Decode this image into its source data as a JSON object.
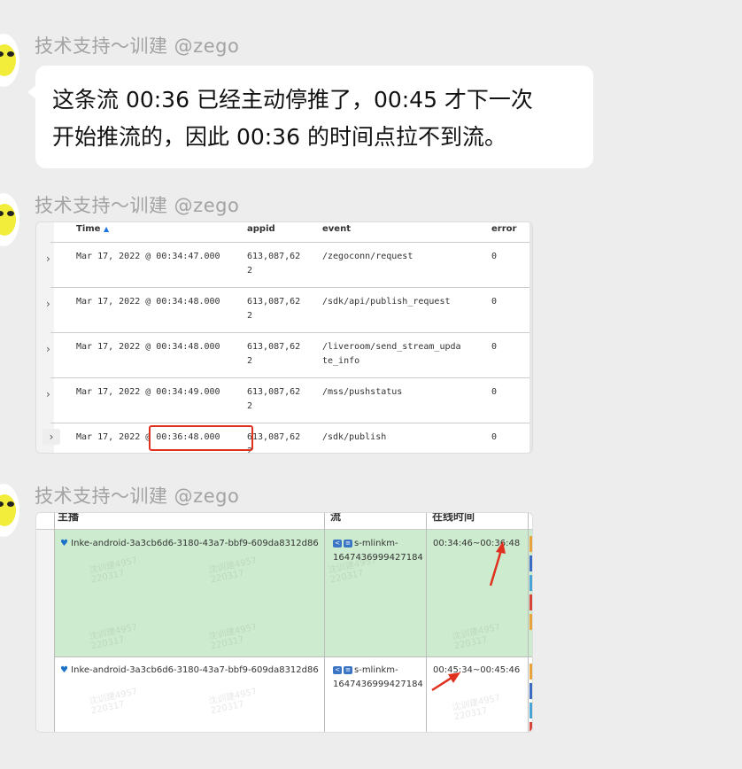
{
  "messages": [
    {
      "sender": "技术支持～训建 @zego",
      "text": "这条流 00:36 已经主动停推了，00:45 才下一次\n开始推流的，因此 00:36 的时间点拉不到流。"
    },
    {
      "sender": "技术支持～训建 @zego"
    },
    {
      "sender": "技术支持～训建 @zego"
    }
  ],
  "log_table": {
    "columns": [
      "Time",
      "appid",
      "event",
      "error"
    ],
    "sort_icon": "▲",
    "rows": [
      {
        "time": "Mar 17, 2022 @ 00:34:47.000",
        "appid": "613,087,62\n2",
        "event": "/zegoconn/request",
        "error": "0"
      },
      {
        "time": "Mar 17, 2022 @ 00:34:48.000",
        "appid": "613,087,62\n2",
        "event": "/sdk/api/publish_request",
        "error": "0"
      },
      {
        "time": "Mar 17, 2022 @ 00:34:48.000",
        "appid": "613,087,62\n2",
        "event": "/liveroom/send_stream_upda\nte_info",
        "error": "0"
      },
      {
        "time": "Mar 17, 2022 @ 00:34:49.000",
        "appid": "613,087,62\n2",
        "event": "/mss/pushstatus",
        "error": "0"
      },
      {
        "time": "Mar 17, 2022 @ 00:36:48.000",
        "appid": "613,087,62\n2",
        "event": "/sdk/publish",
        "error": "0"
      }
    ],
    "highlight_color": "#e0301e"
  },
  "stream_table": {
    "columns": [
      "主播",
      "流",
      "在线时间"
    ],
    "rows": [
      {
        "anchor": "Inke-android-3a3cb6d6-3180-43a7-bbf9-609da8312d86",
        "stream": "s-mlinkm-\n1647436999427184",
        "online": "00:34:46~00:36:48"
      },
      {
        "anchor": "Inke-android-3a3cb6d6-3180-43a7-bbf9-609da8312d86",
        "stream": "s-mlinkm-\n1647436999427184",
        "online": "00:45:34~00:45:46"
      }
    ],
    "watermark": "沈训建4957\n220317",
    "row_highlight": "#cdeccf",
    "arrow_color": "#e0301e"
  }
}
